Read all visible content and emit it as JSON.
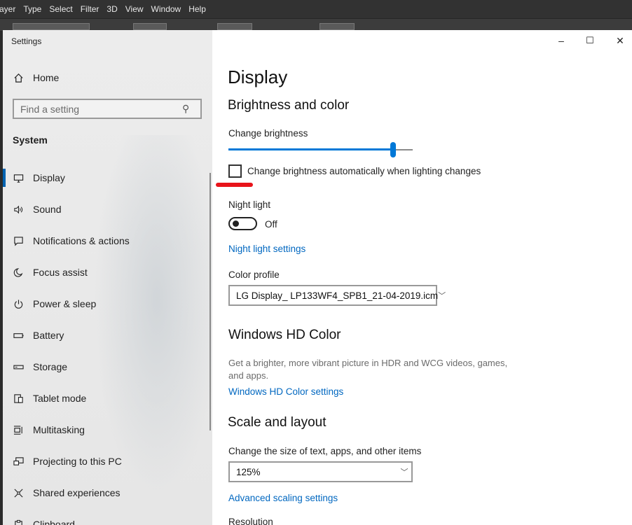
{
  "photoshop": {
    "menu": [
      "ayer",
      "Type",
      "Select",
      "Filter",
      "3D",
      "View",
      "Window",
      "Help"
    ]
  },
  "window": {
    "title": "Settings",
    "minimize_glyph": "–",
    "maximize_glyph": "☐",
    "close_glyph": "✕"
  },
  "sidebar": {
    "home": "Home",
    "search_placeholder": "Find a setting",
    "section": "System",
    "items": [
      {
        "label": "Display",
        "icon": "monitor-icon"
      },
      {
        "label": "Sound",
        "icon": "speaker-icon"
      },
      {
        "label": "Notifications & actions",
        "icon": "notification-icon"
      },
      {
        "label": "Focus assist",
        "icon": "moon-icon"
      },
      {
        "label": "Power & sleep",
        "icon": "power-icon"
      },
      {
        "label": "Battery",
        "icon": "battery-icon"
      },
      {
        "label": "Storage",
        "icon": "storage-icon"
      },
      {
        "label": "Tablet mode",
        "icon": "tablet-icon"
      },
      {
        "label": "Multitasking",
        "icon": "multitasking-icon"
      },
      {
        "label": "Projecting to this PC",
        "icon": "projecting-icon"
      },
      {
        "label": "Shared experiences",
        "icon": "shared-icon"
      },
      {
        "label": "Clipboard",
        "icon": "clipboard-icon"
      }
    ],
    "active_index": 0
  },
  "content": {
    "title": "Display",
    "brightness_heading": "Brightness and color",
    "brightness_label": "Change brightness",
    "brightness_value": 0.9,
    "auto_brightness_label": "Change brightness automatically when lighting changes",
    "auto_brightness_checked": false,
    "night_light_label": "Night light",
    "night_light_state": "Off",
    "night_light_settings_link": "Night light settings",
    "color_profile_label": "Color profile",
    "color_profile_value": "LG Display_  LP133WF4_SPB1_21-04-2019.icm",
    "hd_heading": "Windows HD Color",
    "hd_desc": "Get a brighter, more vibrant picture in HDR and WCG videos, games, and apps.",
    "hd_link": "Windows HD Color settings",
    "scale_heading": "Scale and layout",
    "scale_label": "Change the size of text, apps, and other items",
    "scale_value": "125%",
    "advanced_scaling_link": "Advanced scaling settings",
    "resolution_label": "Resolution"
  },
  "colors": {
    "accent": "#0078d7",
    "link": "#0067c0",
    "annotation": "#e8141b"
  }
}
